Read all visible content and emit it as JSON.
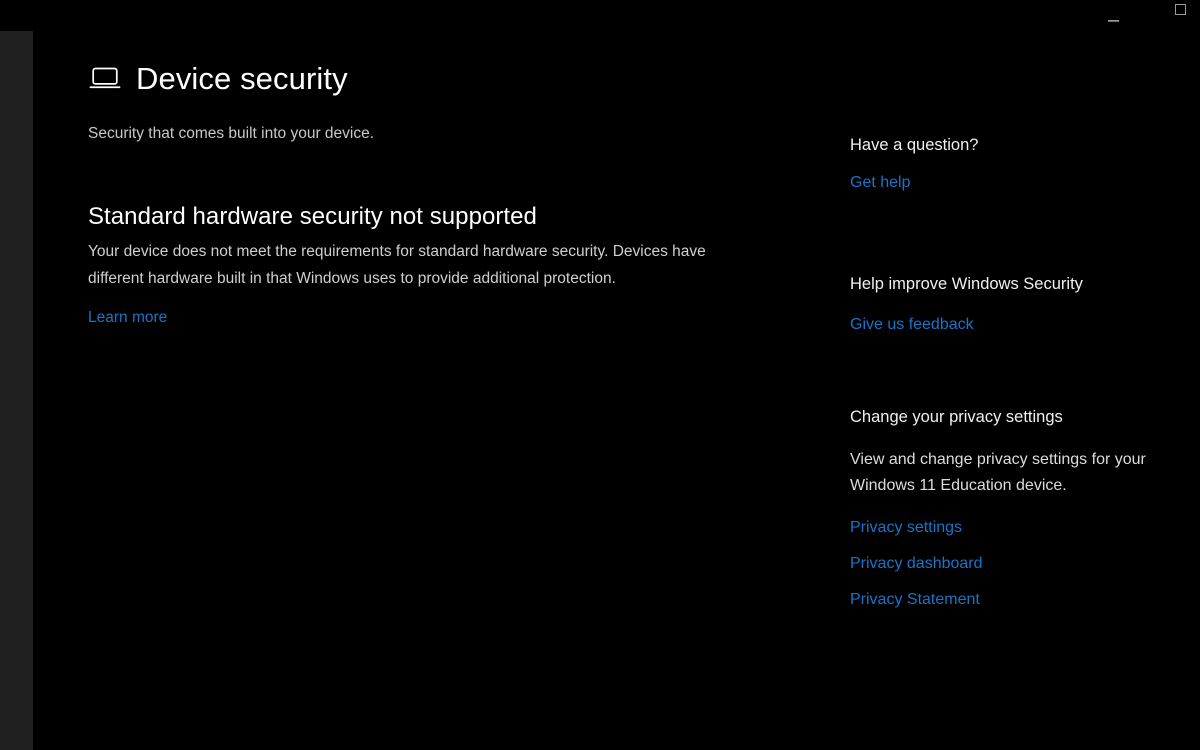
{
  "window": {
    "title": "Device security",
    "controls": {
      "minimize_label": "Minimize",
      "maximize_label": "Maximize"
    }
  },
  "colors": {
    "background": "#000000",
    "nav_rail": "#202020",
    "link": "#1a73c8",
    "heading_text": "#ffffff",
    "body_text": "#cfcfcf"
  },
  "page": {
    "icon": "laptop-icon",
    "title": "Device security",
    "subtitle": "Security that comes built into your device."
  },
  "status": {
    "heading": "Standard hardware security not supported",
    "description": "Your device does not meet the requirements for standard hardware security. Devices have different hardware built in that Windows uses to provide additional protection.",
    "learn_more_label": "Learn more"
  },
  "aside": {
    "question": {
      "heading": "Have a question?",
      "link_label": "Get help"
    },
    "feedback": {
      "heading": "Help improve Windows Security",
      "link_label": "Give us feedback"
    },
    "privacy": {
      "heading": "Change your privacy settings",
      "description": "View and change privacy settings for your Windows 11 Education device.",
      "settings_label": "Privacy settings",
      "dashboard_label": "Privacy dashboard",
      "statement_label": "Privacy Statement"
    }
  }
}
